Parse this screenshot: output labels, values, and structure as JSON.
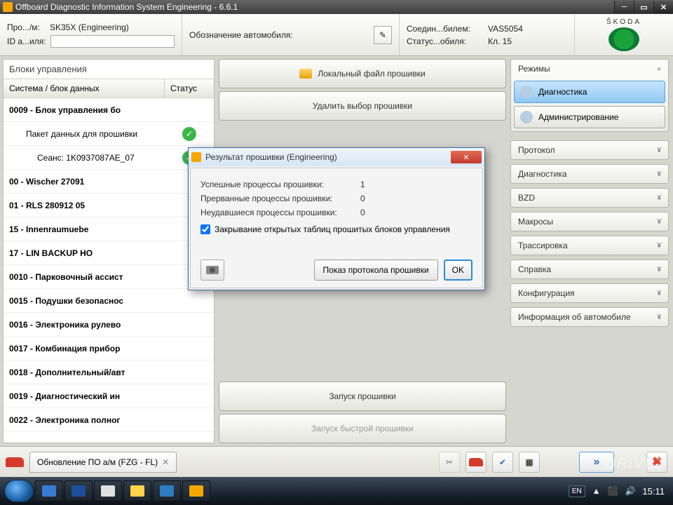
{
  "titlebar": {
    "title": "Offboard Diagnostic Information System Engineering - 6.6.1"
  },
  "info": {
    "proj_lbl": "Про.../м:",
    "proj_val": "SK35X   (Engineering)",
    "id_lbl": "ID а...иля:",
    "id_val": "",
    "vehicle_lbl": "Обозначение автомобиля:",
    "conn_lbl": "Соедин...билем:",
    "conn_val": "VAS5054",
    "status_lbl": "Статус...обиля:",
    "status_val": "Кл. 15",
    "brand": "ŠKODA"
  },
  "left": {
    "title": "Блоки управления",
    "col1": "Система / блок данных",
    "col2": "Статус",
    "rows": [
      {
        "txt": "0009 - Блок управления бо",
        "bold": true
      },
      {
        "txt": "Пакет данных для прошивки",
        "indent": 1,
        "ok": true
      },
      {
        "txt": "Сеанс: 1K0937087AE_07",
        "indent": 2,
        "ok": true
      },
      {
        "txt": "00 - Wischer 27091",
        "bold": true
      },
      {
        "txt": "01 - RLS 280912 05",
        "bold": true
      },
      {
        "txt": "15 - Innenraumuebe",
        "bold": true
      },
      {
        "txt": "17 - LIN BACKUP HO",
        "bold": true
      },
      {
        "txt": "0010 - Парковочный ассист",
        "bold": true
      },
      {
        "txt": "0015 - Подушки безопаснос",
        "bold": true
      },
      {
        "txt": "0016 - Электроника рулево",
        "bold": true
      },
      {
        "txt": "0017 - Комбинация прибор",
        "bold": true
      },
      {
        "txt": "0018 - Дополнительный/авт",
        "bold": true
      },
      {
        "txt": "0019 - Диагностический ин",
        "bold": true
      },
      {
        "txt": "0022 - Электроника полног",
        "bold": true
      }
    ]
  },
  "center": {
    "btn_local": "Локальный файл прошивки",
    "btn_delete_sel": "Удалить выбор прошивки",
    "btn_start": "Запуск прошивки",
    "btn_fast": "Запуск быстрой прошивки"
  },
  "right": {
    "modes_title": "Режимы",
    "mode_diag": "Диагностика",
    "mode_admin": "Администрирование",
    "sections": [
      "Протокол",
      "Диагностика",
      "BZD",
      "Макросы",
      "Трассировка",
      "Справка",
      "Конфигурация",
      "Информация об автомобиле"
    ]
  },
  "dialog": {
    "title": "Результат прошивки (Engineering)",
    "row1k": "Успешные процессы прошивки:",
    "row1v": "1",
    "row2k": "Прерванные процессы прошивки:",
    "row2v": "0",
    "row3k": "Неудавшиеся процессы прошивки:",
    "row3v": "0",
    "chk": "Закрывание открытых таблиц прошитых блоков управления",
    "btn_proto": "Показ протокола прошивки",
    "btn_ok": "OK"
  },
  "bottom": {
    "tab": "Обновление ПО а/м (FZG - FL)"
  },
  "tray": {
    "lang": "EN",
    "time": "15:11"
  },
  "watermark": "DRIVE2"
}
